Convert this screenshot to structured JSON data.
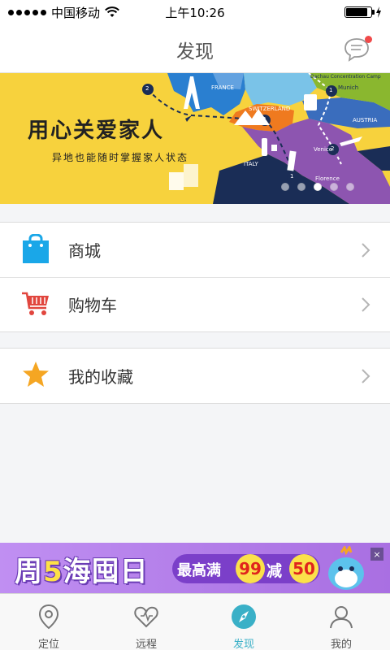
{
  "status_bar": {
    "carrier": "中国移动",
    "time": "上午10:26",
    "battery_level": 0.85
  },
  "nav": {
    "title": "发现",
    "message_icon": "chat-bubble-icon",
    "has_unread": true
  },
  "banner": {
    "headline": "用心关爱家人",
    "subline": "异地也能随时掌握家人状态",
    "map_labels": [
      "FRANCE",
      "SWITZERLAND",
      "AUSTRIA",
      "ITALY",
      "Munich",
      "Venice",
      "Florence",
      "Dachau Concentration Camp"
    ],
    "route_numbers": [
      "2",
      "1",
      "2",
      "2",
      "1"
    ],
    "slide_count": 5,
    "active_slide": 2
  },
  "menu": {
    "group1": [
      {
        "label": "商城",
        "icon": "shopping-bag-icon"
      },
      {
        "label": "购物车",
        "icon": "shopping-cart-icon"
      }
    ],
    "group2": [
      {
        "label": "我的收藏",
        "icon": "star-icon"
      }
    ]
  },
  "ad": {
    "title_prefix": "周",
    "title_number": "5",
    "title_suffix": "海囤日",
    "max_text": "最高满",
    "amount_threshold": "99",
    "minus_text": "减",
    "amount_off": "50",
    "close_symbol": "×"
  },
  "tabs": [
    {
      "label": "定位",
      "icon": "location-pin-icon",
      "active": false
    },
    {
      "label": "远程",
      "icon": "heart-icon",
      "active": false
    },
    {
      "label": "发现",
      "icon": "compass-icon",
      "active": true
    },
    {
      "label": "我的",
      "icon": "user-icon",
      "active": false
    }
  ],
  "colors": {
    "accent": "#3ab0c7",
    "banner_bg": "#f7d23d",
    "ad_bg": "#b37ee9",
    "badge_red": "#f04a4a"
  }
}
